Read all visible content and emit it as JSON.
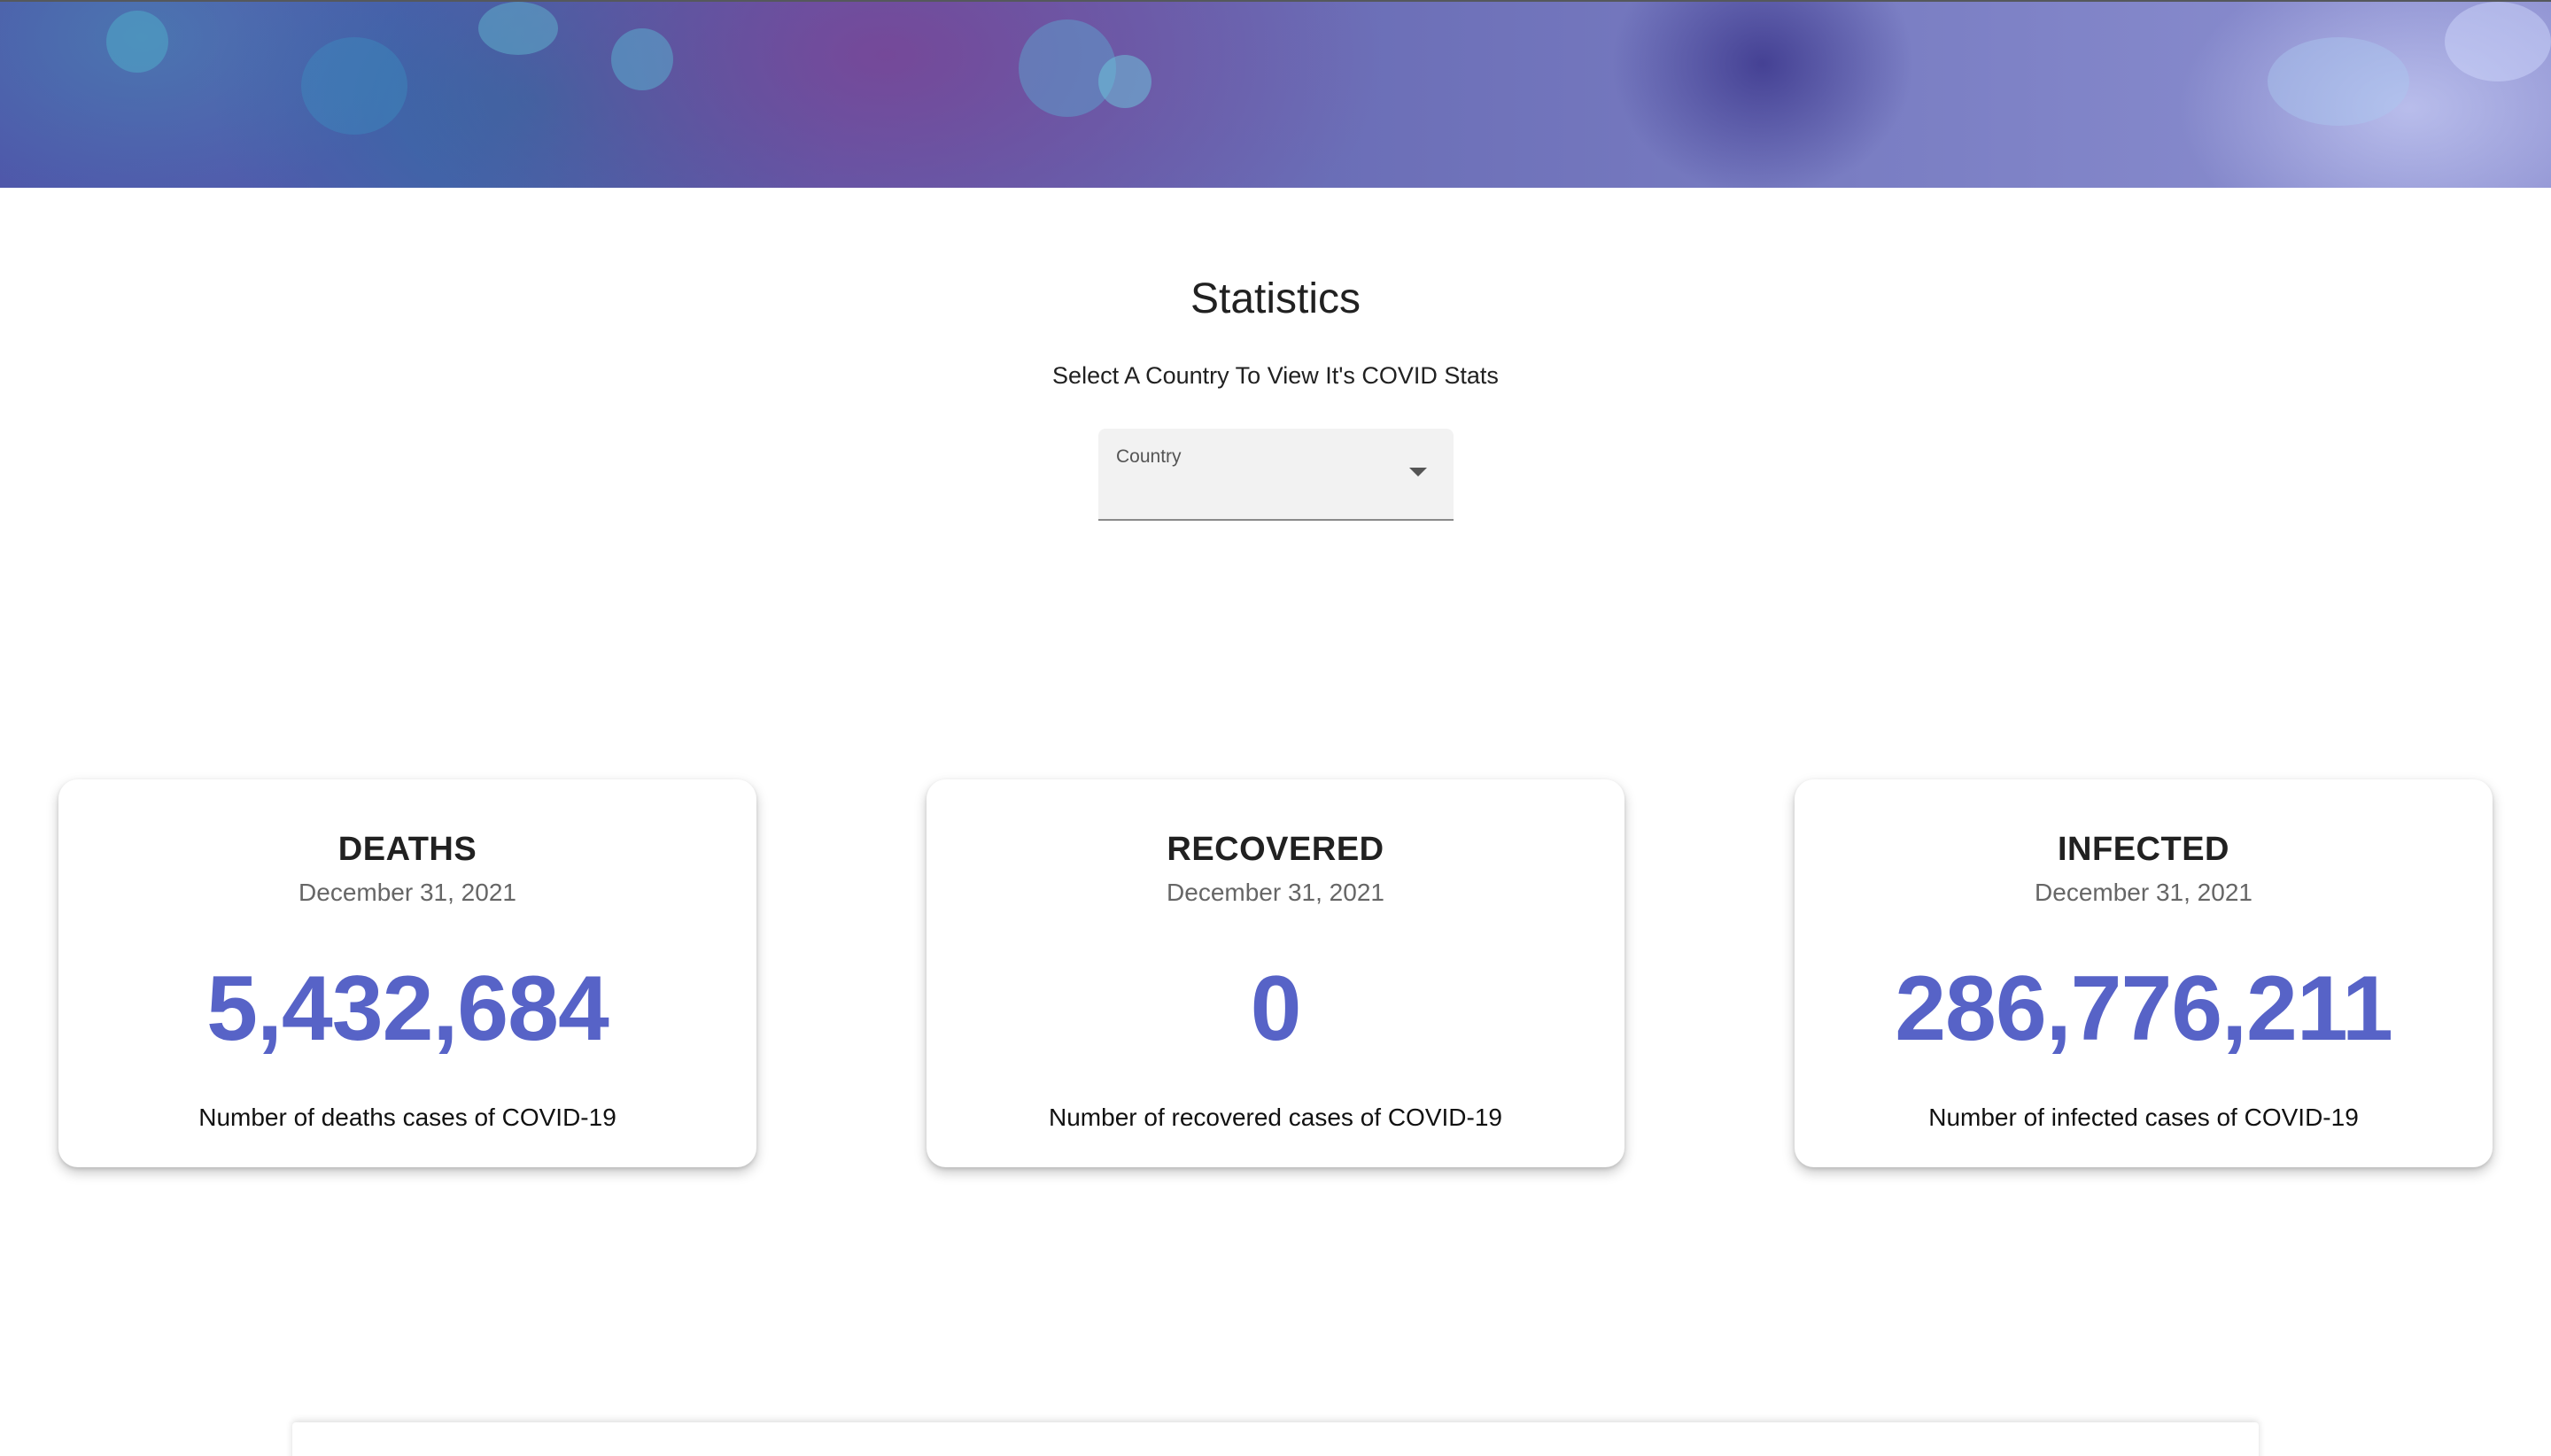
{
  "page": {
    "title": "Statistics",
    "subtitle": "Select A Country To View It's COVID Stats"
  },
  "country_select": {
    "label": "Country",
    "selected_value": ""
  },
  "cards": [
    {
      "title": "DEATHS",
      "date": "December 31, 2021",
      "value": "5,432,684",
      "caption": "Number of deaths cases of COVID-19"
    },
    {
      "title": "RECOVERED",
      "date": "December 31, 2021",
      "value": "0",
      "caption": "Number of recovered cases of COVID-19"
    },
    {
      "title": "INFECTED",
      "date": "December 31, 2021",
      "value": "286,776,211",
      "caption": "Number of infected cases of COVID-19"
    }
  ],
  "colors": {
    "accent": "#5763c7",
    "hero_base": "#5560b0",
    "text_primary": "#212121",
    "text_secondary": "#666666"
  },
  "icons": {
    "select_arrow": "arrow-drop-down-icon"
  }
}
